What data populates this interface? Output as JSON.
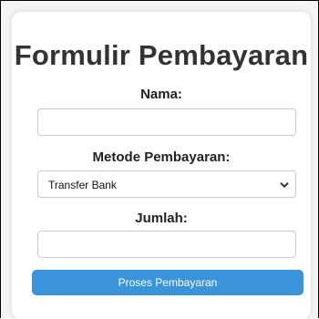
{
  "form": {
    "title": "Formulir Pembayaran",
    "name_label": "Nama:",
    "name_value": "",
    "method_label": "Metode Pembayaran:",
    "method_selected": "Transfer Bank",
    "amount_label": "Jumlah:",
    "amount_value": "",
    "submit_label": "Proses Pembayaran"
  },
  "icons": {
    "select_arrow": "chevron-down-icon"
  },
  "colors": {
    "button": "#3a94db",
    "title": "#333333"
  }
}
